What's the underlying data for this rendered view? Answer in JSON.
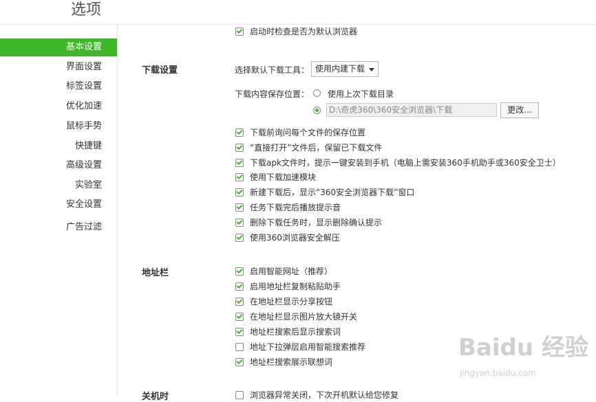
{
  "header": {
    "title": "选项"
  },
  "sidebar": {
    "items": [
      {
        "label": "基本设置",
        "active": true
      },
      {
        "label": "界面设置"
      },
      {
        "label": "标签设置"
      },
      {
        "label": "优化加速"
      },
      {
        "label": "鼠标手势"
      },
      {
        "label": "快捷键"
      },
      {
        "label": "高级设置"
      },
      {
        "label": "实验室"
      },
      {
        "label": "安全设置"
      },
      {
        "label": "广告过滤"
      }
    ]
  },
  "startup": {
    "check_default_label": "启动时检查是否为默认浏览器",
    "checked": true
  },
  "download": {
    "section_label": "下载设置",
    "tool_label": "选择默认下载工具：",
    "tool_value": "使用内建下载",
    "save_label": "下载内容保存位置：",
    "radio_last": "使用上次下载目录",
    "radio_last_selected": false,
    "radio_custom_selected": true,
    "path_value": "D:\\奇虎360\\360安全浏览器\\下载",
    "change_button": "更改...",
    "options": [
      {
        "label": "下载前询问每个文件的保存位置",
        "checked": true
      },
      {
        "label": "“直接打开”文件后，保留已下载文件",
        "checked": true
      },
      {
        "label": "下载apk文件时，提示一键安装到手机（电脑上需安装360手机助手或360安全卫士）",
        "checked": true
      },
      {
        "label": "使用下载加速模块",
        "checked": true
      },
      {
        "label": "新建下载后，显示“360安全浏览器下载”窗口",
        "checked": true
      },
      {
        "label": "任务下载完后播放提示音",
        "checked": true
      },
      {
        "label": "删除下载任务时，显示删除确认提示",
        "checked": true
      },
      {
        "label": "使用360浏览器安全解压",
        "checked": true
      }
    ]
  },
  "addressbar": {
    "section_label": "地址栏",
    "options": [
      {
        "label": "启用智能网址（推荐）",
        "checked": true
      },
      {
        "label": "启用地址栏复制粘贴助手",
        "checked": true
      },
      {
        "label": "在地址栏显示分享按钮",
        "checked": true
      },
      {
        "label": "在地址栏显示图片放大镜开关",
        "checked": true
      },
      {
        "label": "地址栏搜索后显示搜索词",
        "checked": true
      },
      {
        "label": "地址下拉弹层启用智能搜索推荐",
        "checked": false
      },
      {
        "label": "地址栏搜索展示联想词",
        "checked": true
      }
    ]
  },
  "shutdown": {
    "section_label": "关机时",
    "option_label": "浏览器异常关闭，下次开机默认给您修复"
  },
  "watermark": {
    "brand": "Baidu 经验",
    "url": "jingyan.baidu.com"
  },
  "colors": {
    "accent": "#3fb72a"
  }
}
